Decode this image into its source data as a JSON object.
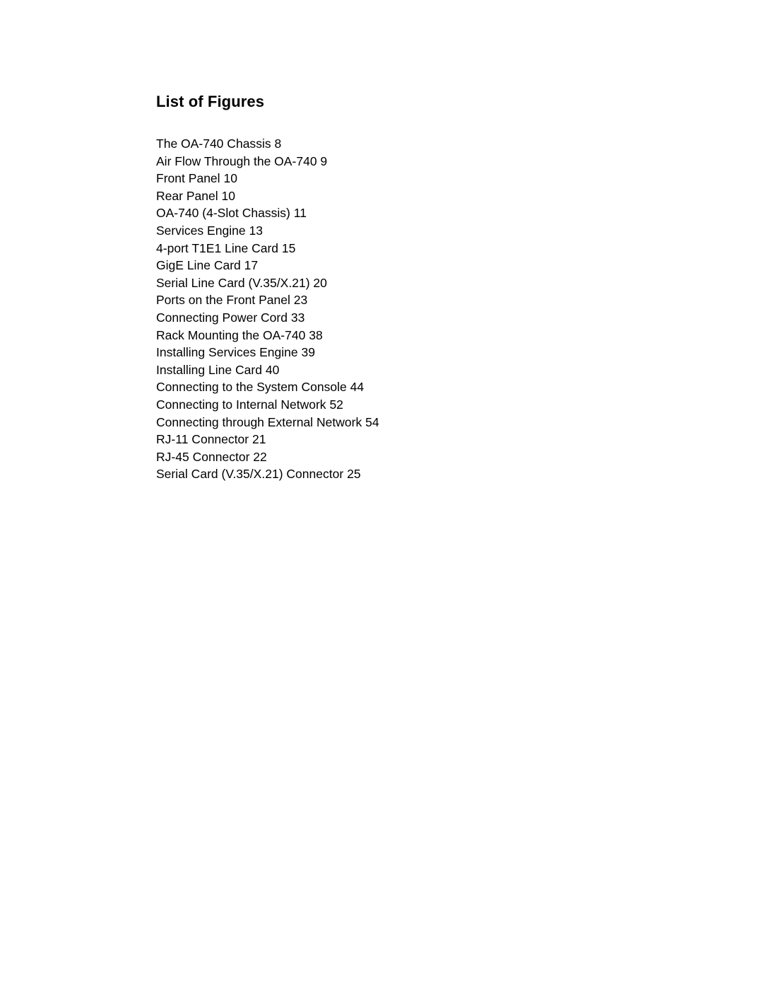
{
  "document": {
    "heading": "List of Figures",
    "entries": [
      "The OA-740 Chassis 8",
      "Air Flow Through the OA-740 9",
      "Front Panel 10",
      "Rear Panel 10",
      "OA-740 (4-Slot Chassis) 11",
      "Services Engine 13",
      "4-port T1E1 Line Card 15",
      "GigE Line Card 17",
      "Serial Line Card (V.35/X.21) 20",
      "Ports on the Front Panel 23",
      "Connecting Power Cord 33",
      "Rack Mounting the OA-740 38",
      "Installing Services Engine 39",
      "Installing Line Card 40",
      "Connecting to the System Console 44",
      "Connecting to Internal Network 52",
      "Connecting through External Network 54",
      "RJ-11 Connector 21",
      "RJ-45 Connector 22",
      "Serial Card (V.35/X.21) Connector 25"
    ]
  }
}
